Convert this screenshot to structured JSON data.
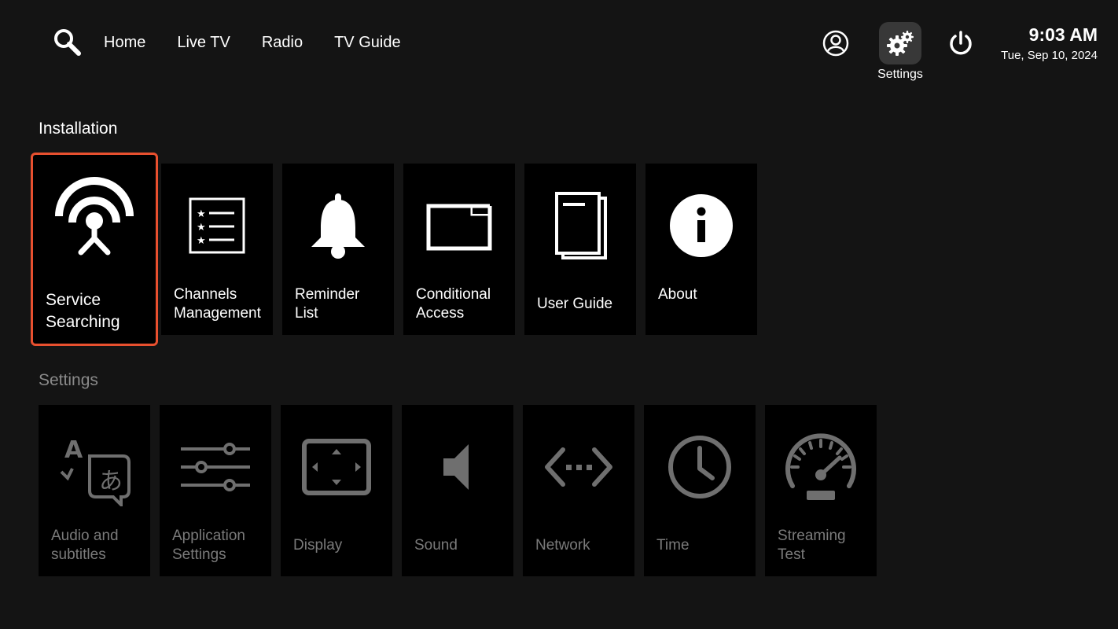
{
  "nav": {
    "items": [
      "Home",
      "Live TV",
      "Radio",
      "TV Guide"
    ]
  },
  "top_right": {
    "settings_caption": "Settings",
    "time": "9:03 AM",
    "date": "Tue, Sep 10, 2024"
  },
  "colors": {
    "background": "#141414",
    "tile": "#000000",
    "focus_border": "#e8502f",
    "disabled_text": "#7a7a7a"
  },
  "installation": {
    "title": "Installation",
    "tiles": [
      {
        "label_1": "Service",
        "label_2": "Searching",
        "icon": "antenna-icon"
      },
      {
        "label_1": "Channels",
        "label_2": "Management",
        "icon": "channel-list-icon"
      },
      {
        "label_1": "Reminder",
        "label_2": "List",
        "icon": "bell-icon"
      },
      {
        "label_1": "Conditional",
        "label_2": "Access",
        "icon": "ci-card-icon"
      },
      {
        "label_1": "User Guide",
        "icon": "document-icon"
      },
      {
        "label_1": "About",
        "icon": "info-icon"
      }
    ]
  },
  "settings": {
    "title": "Settings",
    "tiles": [
      {
        "label_1": "Audio and",
        "label_2": "subtitles",
        "icon": "translate-icon"
      },
      {
        "label_1": "Application",
        "label_2": "Settings",
        "icon": "sliders-icon"
      },
      {
        "label_1": "Display",
        "icon": "display-icon"
      },
      {
        "label_1": "Sound",
        "icon": "speaker-icon"
      },
      {
        "label_1": "Network",
        "icon": "network-icon"
      },
      {
        "label_1": "Time",
        "icon": "clock-icon"
      },
      {
        "label_1": "Streaming",
        "label_2": "Test",
        "icon": "speedometer-icon"
      }
    ]
  }
}
